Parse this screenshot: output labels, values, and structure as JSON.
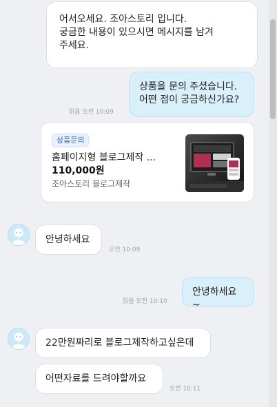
{
  "messages": {
    "greeting": {
      "line1": "어서오세요. 조아스토리 입니다.",
      "line2": "궁금한 내용이 있으시면 메시지를 남겨",
      "line3": "주세요."
    },
    "inquiry": {
      "line1": "상품을 문의 주셨습니다.",
      "line2": "어떤 점이 궁금하신가요?",
      "meta": "읽음 오전 10:09"
    },
    "product_card": {
      "tag": "상품문의",
      "title": "홈페이지형 블로그제작 ...",
      "price": "110,000원",
      "seller": "조아스토리 블로그제작"
    },
    "user1": {
      "text": "안녕하세요",
      "meta": "오전 10:09"
    },
    "me2": {
      "text": "안녕하세요~",
      "meta": "읽음 오전 10:10"
    },
    "user2": {
      "text1": "22만원짜리로 블로그제작하고싶은데",
      "text2": "어떤자료를 드려야할까요",
      "meta": "오전 10:11"
    }
  },
  "colors": {
    "background": "#eef0f3",
    "my_bubble": "#d9effa",
    "other_bubble": "#ffffff"
  },
  "icons": [
    "avatar-icon",
    "scrollbar"
  ]
}
